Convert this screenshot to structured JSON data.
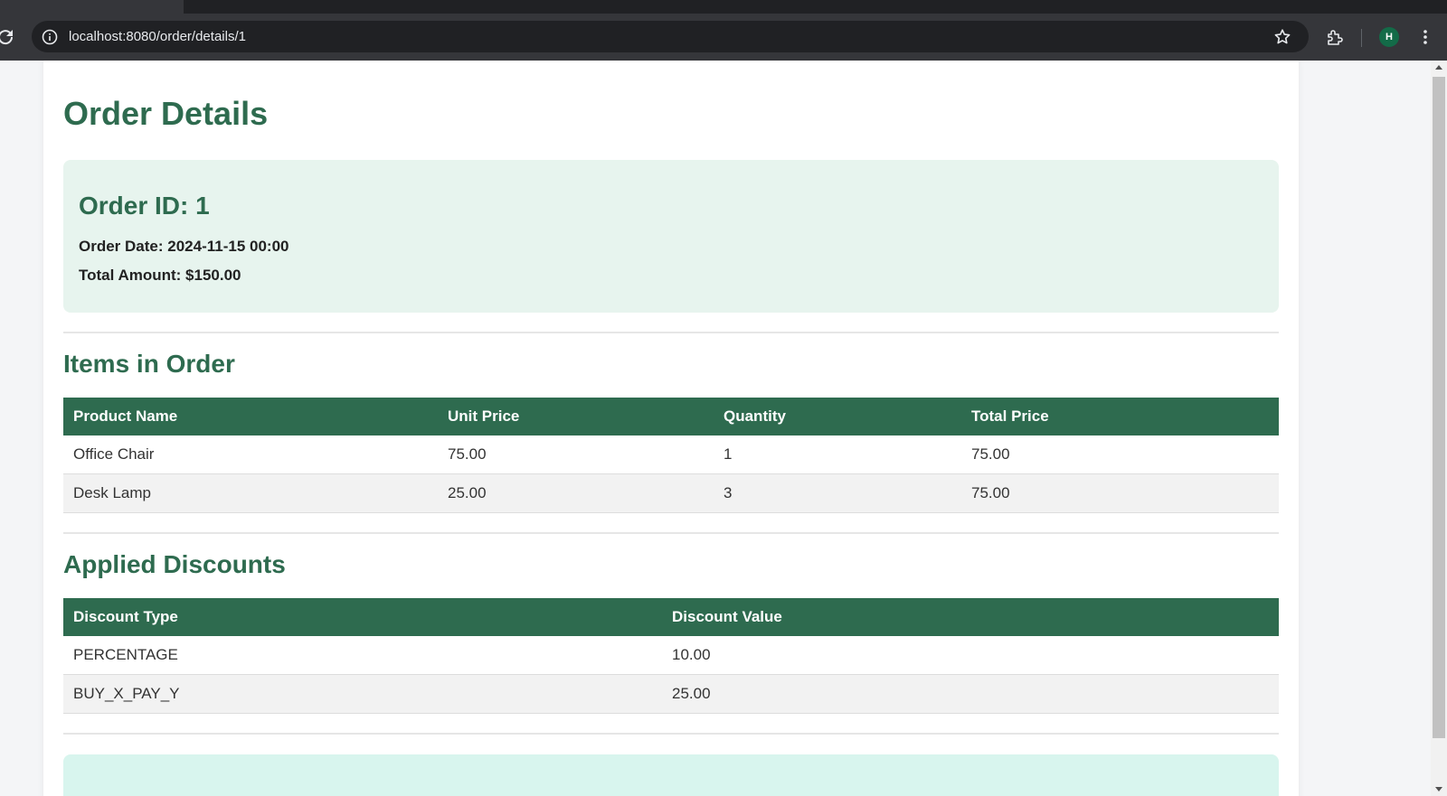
{
  "browser": {
    "url": "localhost:8080/order/details/1",
    "profile_initial": "H"
  },
  "page": {
    "title": "Order Details",
    "order": {
      "id_label": "Order ID: 1",
      "date_label": "Order Date:",
      "date_value": "2024-11-15 00:00",
      "total_label": "Total Amount:",
      "total_value": "$150.00"
    },
    "items_section": {
      "title": "Items in Order",
      "columns": [
        "Product Name",
        "Unit Price",
        "Quantity",
        "Total Price"
      ],
      "rows": [
        [
          "Office Chair",
          "75.00",
          "1",
          "75.00"
        ],
        [
          "Desk Lamp",
          "25.00",
          "3",
          "75.00"
        ]
      ]
    },
    "discounts_section": {
      "title": "Applied Discounts",
      "columns": [
        "Discount Type",
        "Discount Value"
      ],
      "rows": [
        [
          "PERCENTAGE",
          "10.00"
        ],
        [
          "BUY_X_PAY_Y",
          "25.00"
        ]
      ]
    }
  },
  "colors": {
    "accent": "#2e6b4f",
    "summary_bg": "#e7f4ee",
    "bottom_card_bg": "#d8f5ee"
  },
  "icons": [
    "reload-icon",
    "info-icon",
    "star-icon",
    "extensions-icon",
    "more-menu-icon"
  ]
}
